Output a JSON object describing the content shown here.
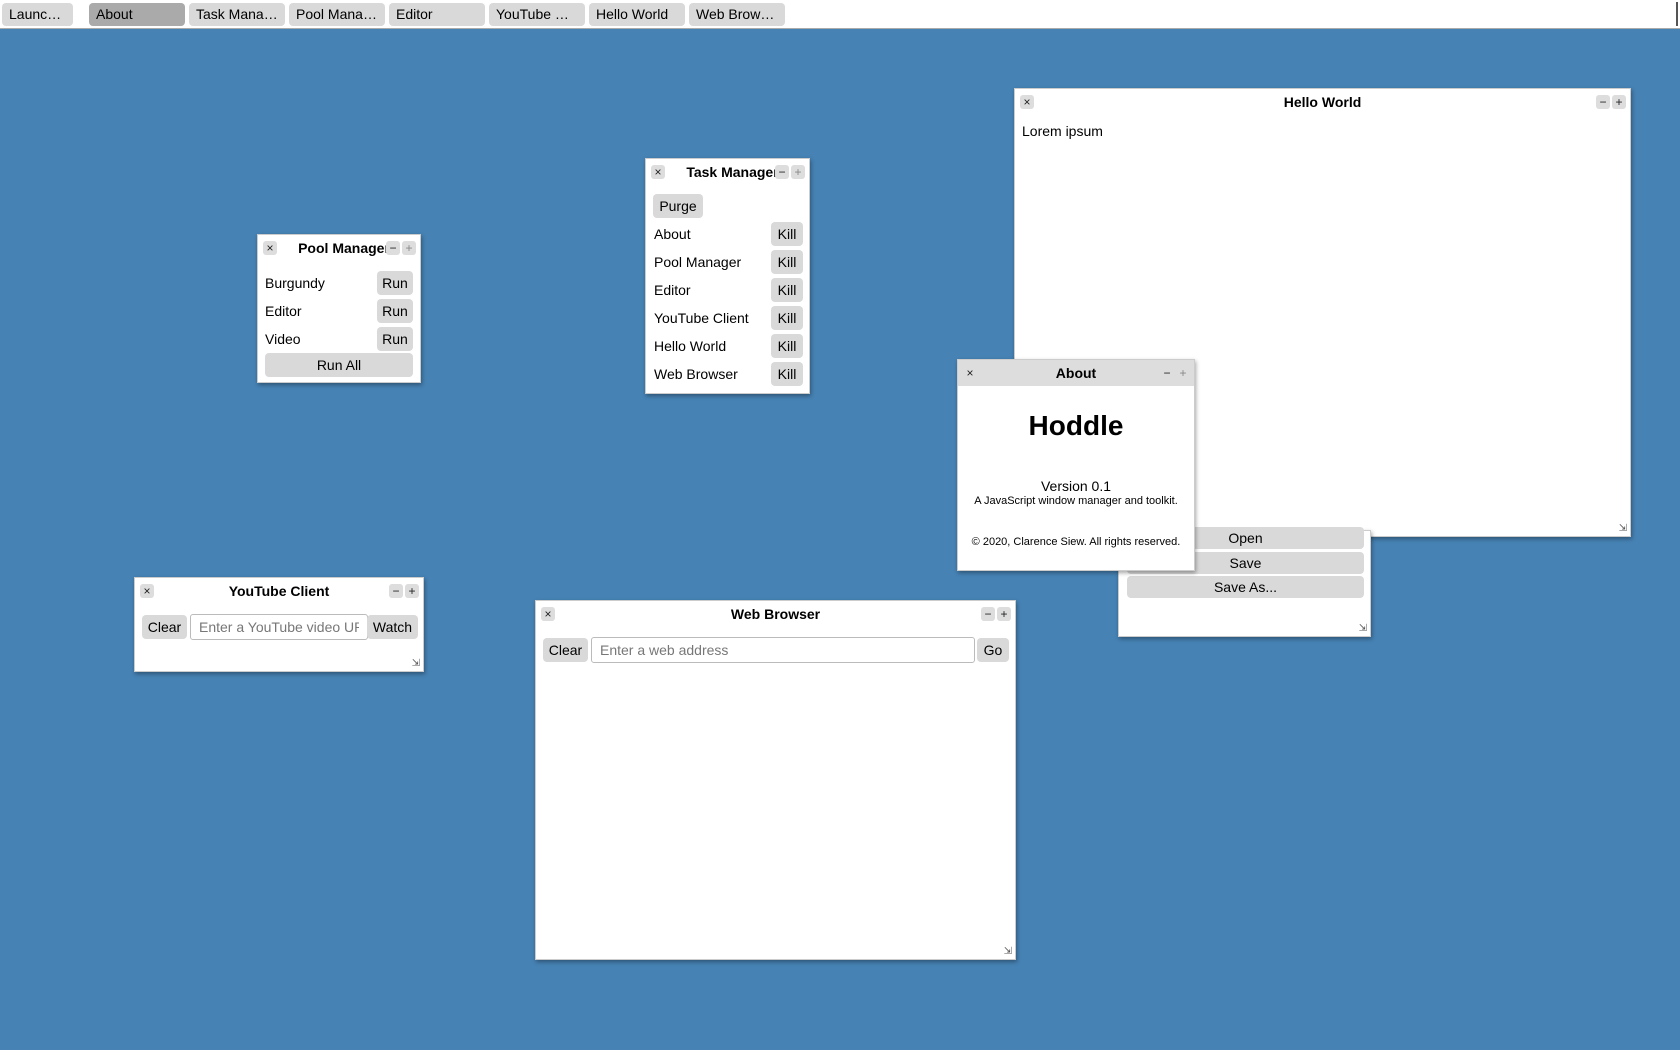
{
  "taskbar": {
    "items": [
      {
        "label": "Launcher"
      },
      {
        "label": "About"
      },
      {
        "label": "Task Manager"
      },
      {
        "label": "Pool Manager"
      },
      {
        "label": "Editor"
      },
      {
        "label": "YouTube Client"
      },
      {
        "label": "Hello World"
      },
      {
        "label": "Web Browser"
      }
    ]
  },
  "icons": {
    "close": "×",
    "minimize": "−",
    "maximize": "+",
    "resize": "⇲"
  },
  "pool_manager": {
    "title": "Pool Manager",
    "items": [
      {
        "label": "Burgundy",
        "action": "Run"
      },
      {
        "label": "Editor",
        "action": "Run"
      },
      {
        "label": "Video",
        "action": "Run"
      }
    ],
    "run_all": "Run All"
  },
  "task_manager": {
    "title": "Task Manager",
    "purge": "Purge",
    "items": [
      {
        "label": "About",
        "action": "Kill"
      },
      {
        "label": "Pool Manager",
        "action": "Kill"
      },
      {
        "label": "Editor",
        "action": "Kill"
      },
      {
        "label": "YouTube Client",
        "action": "Kill"
      },
      {
        "label": "Hello World",
        "action": "Kill"
      },
      {
        "label": "Web Browser",
        "action": "Kill"
      }
    ]
  },
  "hello_world": {
    "title": "Hello World",
    "body": "Lorem ipsum"
  },
  "about": {
    "title": "About",
    "app_name": "Hoddle",
    "version": "Version 0.1",
    "tagline": "A JavaScript window manager and toolkit.",
    "copyright": "© 2020, Clarence Siew. All rights reserved."
  },
  "editor": {
    "open": "Open",
    "save": "Save",
    "save_as": "Save As..."
  },
  "youtube": {
    "title": "YouTube Client",
    "clear": "Clear",
    "placeholder": "Enter a YouTube video URL",
    "watch": "Watch"
  },
  "browser": {
    "title": "Web Browser",
    "clear": "Clear",
    "placeholder": "Enter a web address",
    "go": "Go"
  }
}
